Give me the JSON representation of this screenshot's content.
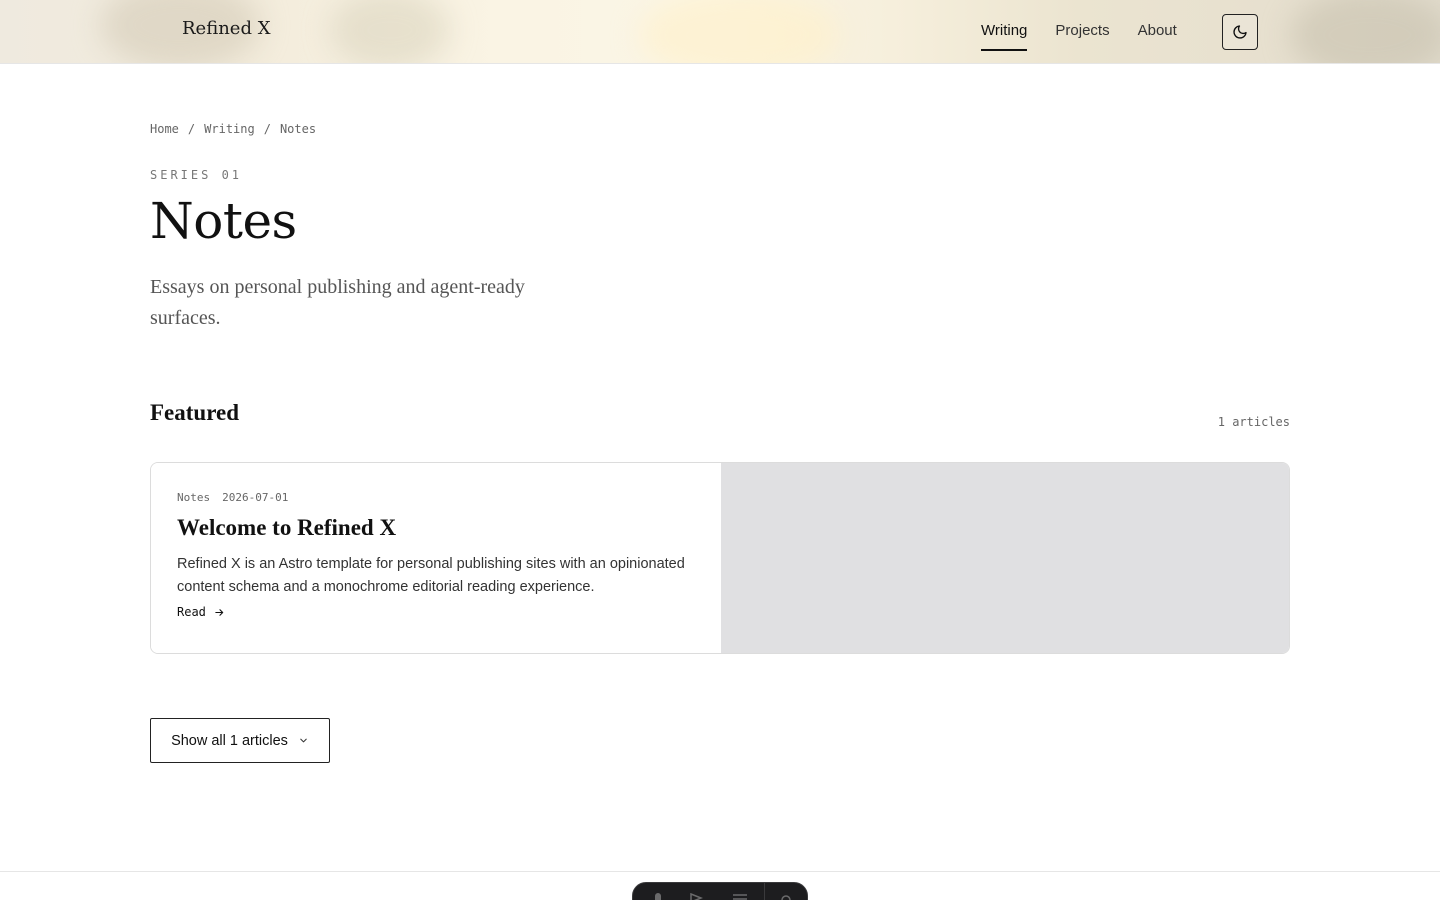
{
  "header": {
    "brand": "Refined X",
    "nav": [
      {
        "label": "Writing",
        "active": true
      },
      {
        "label": "Projects",
        "active": false
      },
      {
        "label": "About",
        "active": false
      }
    ],
    "theme_toggle_icon": "moon-icon"
  },
  "breadcrumb": [
    "Home",
    "Writing",
    "Notes"
  ],
  "breadcrumb_separator": "/",
  "series": {
    "eyebrow": "SERIES 01",
    "title": "Notes",
    "description": "Essays on personal publishing and agent-ready surfaces."
  },
  "featured": {
    "heading": "Featured",
    "count_label": "1 articles",
    "article": {
      "category": "Notes",
      "date": "2026-07-01",
      "title": "Welcome to Refined X",
      "excerpt": "Refined X is an Astro template for personal publishing sites with an opinionated content schema and a monochrome editorial reading experience.",
      "read_label": "Read"
    }
  },
  "show_all_label": "Show all 1 articles",
  "colors": {
    "text": "#1a1a1a",
    "muted": "#666666",
    "card_image_placeholder": "#e0e0e2",
    "dock": "#1d1d1f"
  }
}
